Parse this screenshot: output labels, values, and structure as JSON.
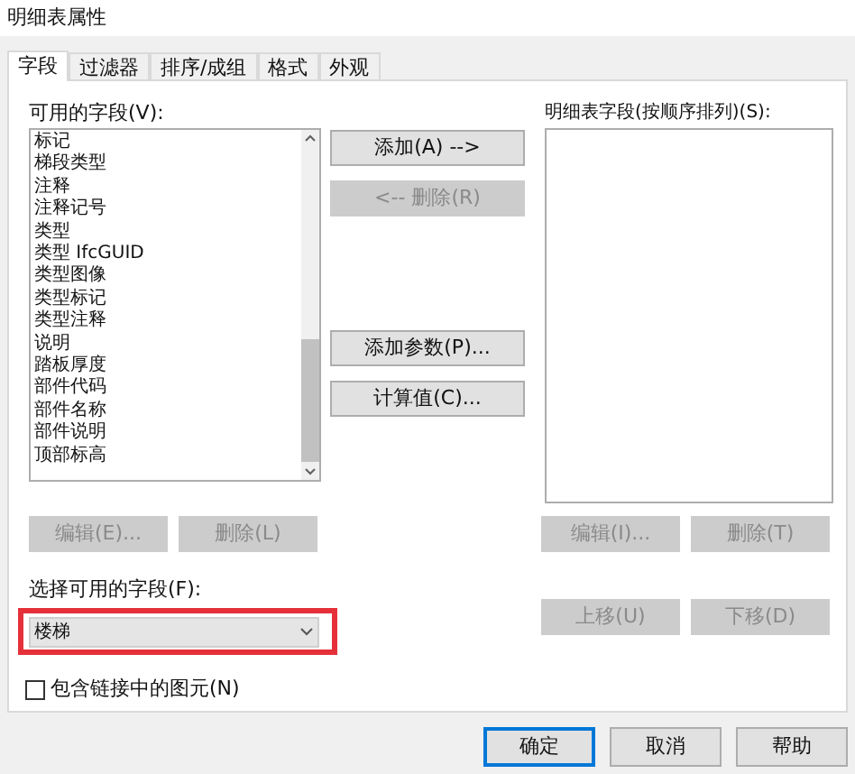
{
  "window": {
    "title": "明细表属性"
  },
  "tabs": [
    {
      "label": "字段",
      "selected": true
    },
    {
      "label": "过滤器",
      "selected": false
    },
    {
      "label": "排序/成组",
      "selected": false
    },
    {
      "label": "格式",
      "selected": false
    },
    {
      "label": "外观",
      "selected": false
    }
  ],
  "available_fields": {
    "label": "可用的字段(V):",
    "items": [
      "标记",
      "梯段类型",
      "注释",
      "注释记号",
      "类型",
      "类型 IfcGUID",
      "类型图像",
      "类型标记",
      "类型注释",
      "说明",
      "踏板厚度",
      "部件代码",
      "部件名称",
      "部件说明",
      "顶部标高"
    ]
  },
  "add_remove_buttons": [
    {
      "label": "添加(A) -->",
      "disabled": false
    },
    {
      "label": "<-- 删除(R)",
      "disabled": true
    }
  ],
  "extra_buttons": [
    {
      "label": "添加参数(P)...",
      "disabled": false
    },
    {
      "label": "计算值(C)...",
      "disabled": false
    }
  ],
  "schedule_fields": {
    "label": "明细表字段(按顺序排列)(S):"
  },
  "left_actions": [
    {
      "label": "编辑(E)...",
      "disabled": true
    },
    {
      "label": "删除(L)",
      "disabled": true
    }
  ],
  "right_actions": [
    {
      "label": "编辑(I)...",
      "disabled": true
    },
    {
      "label": "删除(T)",
      "disabled": true
    }
  ],
  "move_buttons": [
    {
      "label": "上移(U)",
      "disabled": true
    },
    {
      "label": "下移(D)",
      "disabled": true
    }
  ],
  "filter": {
    "label": "选择可用的字段(F):",
    "value": "楼梯"
  },
  "include_linked": {
    "label": "包含链接中的图元(N)",
    "checked": false
  },
  "footer_buttons": [
    {
      "label": "确定",
      "default": true
    },
    {
      "label": "取消",
      "default": false
    },
    {
      "label": "帮助",
      "default": false
    }
  ]
}
